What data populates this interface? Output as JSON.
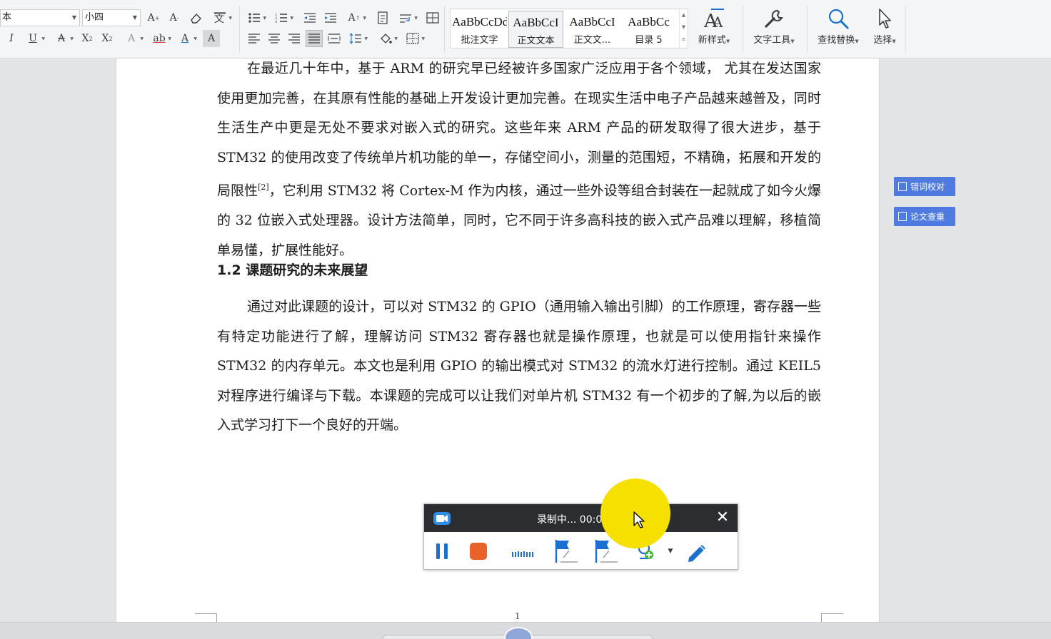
{
  "ribbon": {
    "font_name": "本",
    "font_size": "小四",
    "styles": [
      {
        "preview": "AaBbCcDd",
        "name": "批注文字",
        "selected": false
      },
      {
        "preview": "AaBbCcI",
        "name": "正文文本",
        "selected": true
      },
      {
        "preview": "AaBbCcI",
        "name": "正文文...",
        "selected": false
      },
      {
        "preview": "AaBbCc",
        "name": "目录 5",
        "selected": false
      }
    ],
    "new_style_label": "新样式",
    "text_tools_label": "文字工具",
    "find_replace_label": "查找替换",
    "select_label": "选择",
    "accent_color": "#1b6fd1"
  },
  "document": {
    "para1": "在最近几十年中，基于 ARM 的研究早已经被许多国家广泛应用于各个领域， 尤其在发达国家使用更加完善，在其原有性能的基础上开发设计更加完善。在现实生活中电子产品越来越普及，同时生活生产中更是无处不要求对嵌入式的研究。这些年来 ARM 产品的研发取得了很大进步，基于 STM32 的使用改变了传统单片机功能的单一，存储空间小，测量的范围短，不精确，拓展和开发的局限性",
    "citation": "[2]",
    "para1_tail": "，它利用 STM32 将 Cortex-M 作为内核，通过一些外设等组合封装在一起就成了如今火爆的 32 位嵌入式处理器。设计方法简单，同时，它不同于许多高科技的嵌入式产品难以理解，移植简单易懂，扩展性能好。",
    "heading": "1.2 课题研究的未来展望",
    "para2": "通过对此课题的设计，可以对 STM32 的 GPIO（通用输入输出引脚）的工作原理，寄存器一些有特定功能进行了解，理解访问 STM32 寄存器也就是操作原理，也就是可以使用指针来操作 STM32 的内存单元。本文也是利用 GPIO 的输出模式对 STM32 的流水灯进行控制。通过 KEIL5 对程序进行编译与下载。本课题的完成可以让我们对单片机 STM32 有一个初步的了解,为以后的嵌入式学习打下一个良好的开端。",
    "page_number": "1"
  },
  "side_panel": {
    "proofread_label": "错词校对",
    "plagiarism_label": "论文查重",
    "color": "#4f7ae0"
  },
  "recorder": {
    "status": "录制中... 00:0",
    "close_glyph": "✕",
    "pause_color": "#1b6fd1",
    "stop_color": "#e8622a",
    "highlight_color": "#f5e000"
  }
}
